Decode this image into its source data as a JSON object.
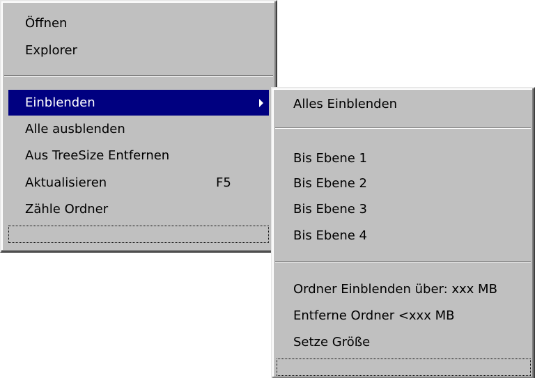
{
  "main_menu": {
    "items": [
      {
        "label": "Öffnen"
      },
      {
        "label": "Explorer"
      },
      {
        "label": "Einblenden",
        "has_submenu": true,
        "highlighted": true
      },
      {
        "label": "Alle ausblenden"
      },
      {
        "label": "Aus TreeSize Entfernen"
      },
      {
        "label": "Aktualisieren",
        "shortcut": "F5"
      },
      {
        "label": "Zähle Ordner"
      }
    ]
  },
  "submenu": {
    "items": [
      {
        "label": "Alles Einblenden"
      },
      {
        "label": "Bis Ebene 1"
      },
      {
        "label": "Bis Ebene 2"
      },
      {
        "label": "Bis Ebene 3"
      },
      {
        "label": "Bis Ebene 4"
      },
      {
        "label": "Ordner Einblenden über: xxx MB"
      },
      {
        "label": "Entferne Ordner <xxx MB"
      },
      {
        "label": "Setze Größe"
      }
    ]
  },
  "colors": {
    "menu_background": "#c0c0c0",
    "highlight": "#000080",
    "highlight_text": "#ffffff"
  }
}
